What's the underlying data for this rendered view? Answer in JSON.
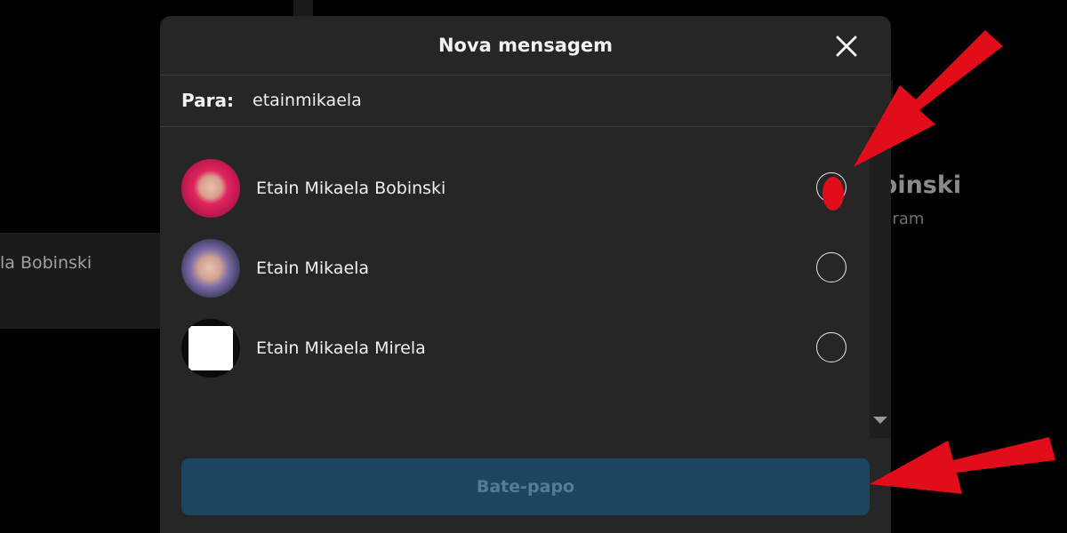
{
  "background": {
    "chat_list_item_name": "la Bobinski",
    "profile_name": "binski",
    "profile_subtitle": "gram"
  },
  "modal": {
    "title": "Nova mensagem",
    "close_icon": "close-icon",
    "to_label": "Para:",
    "to_value": "etainmikaela",
    "results": [
      {
        "name": "Etain Mikaela Bobinski",
        "selected": true
      },
      {
        "name": "Etain Mikaela",
        "selected": false
      },
      {
        "name": "Etain Mikaela Mirela",
        "selected": false
      }
    ],
    "chat_button_label": "Bate-papo"
  },
  "colors": {
    "modal_bg": "#262626",
    "page_bg": "#000000",
    "button_bg": "#1c4562",
    "button_text": "#557b96",
    "annotation_red": "#e10d1a"
  }
}
